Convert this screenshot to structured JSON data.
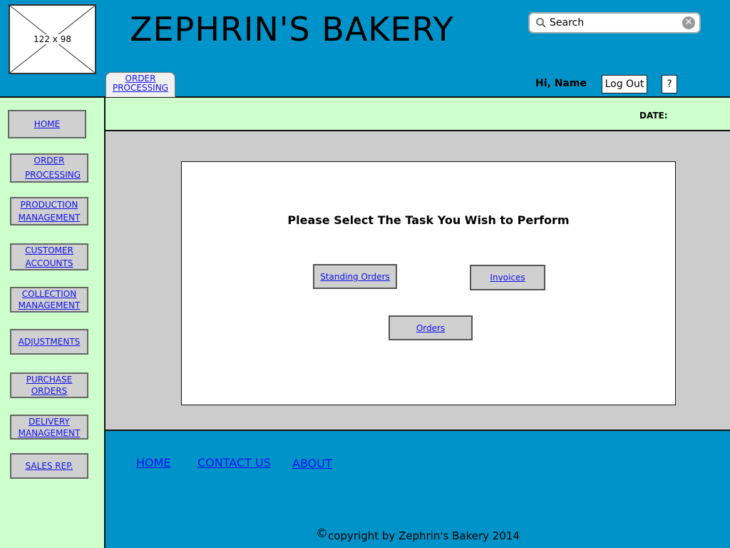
{
  "logo_placeholder": {
    "label": "122 x 98"
  },
  "header": {
    "title": "ZEPHRIN'S BAKERY",
    "search": {
      "placeholder": "Search",
      "value": ""
    },
    "active_tab": {
      "line1": "ORDER",
      "line2": "PROCESSING"
    },
    "greeting": "Hi, Name",
    "logout_label": "Log Out",
    "help_label": "?"
  },
  "sidebar": {
    "items": [
      {
        "line1": "HOME",
        "line2": ""
      },
      {
        "line1": "ORDER",
        "line2": "PROCESSING"
      },
      {
        "line1": "PRODUCTION",
        "line2": "MANAGEMENT"
      },
      {
        "line1": "CUSTOMER",
        "line2": "ACCOUNTS"
      },
      {
        "line1": "COLLECTION",
        "line2": "MANAGEMENT"
      },
      {
        "line1": "ADJUSTMENTS",
        "line2": ""
      },
      {
        "line1": "PURCHASE",
        "line2": "ORDERS"
      },
      {
        "line1": "DELIVERY",
        "line2": "MANAGEMENT"
      },
      {
        "line1": "SALES REP.",
        "line2": ""
      }
    ]
  },
  "date_bar": {
    "label": "DATE:"
  },
  "main": {
    "prompt": "Please Select The Task You Wish to Perform",
    "buttons": {
      "standing_orders": "Standing Orders",
      "invoices": "Invoices",
      "orders": "Orders"
    }
  },
  "footer": {
    "links": {
      "home": "HOME",
      "contact": "CONTACT US",
      "about": "ABOUT"
    },
    "copyright_symbol": "©",
    "copyright": "copyright by Zephrin's Bakery 2014"
  }
}
